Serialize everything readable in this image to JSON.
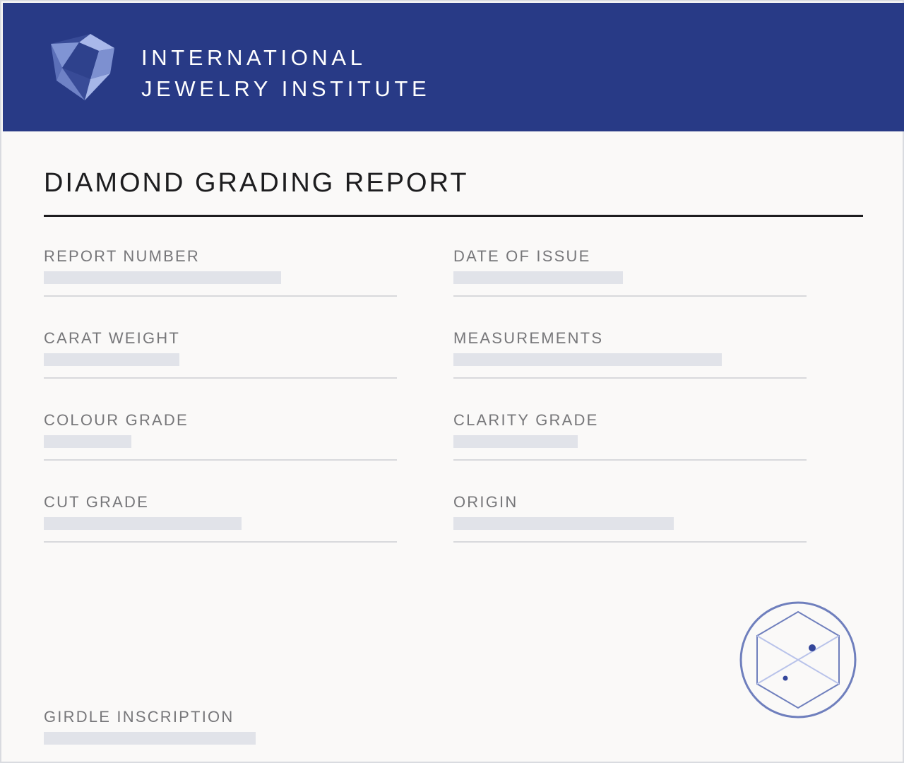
{
  "header": {
    "org_line1": "INTERNATIONAL",
    "org_line2": "JEWELRY INSTITUTE",
    "logo_icon": "shield-triangle-logo-icon",
    "background_color": "#283a86"
  },
  "report": {
    "title": "DIAMOND GRADING REPORT"
  },
  "fields": {
    "report_number": {
      "label": "REPORT NUMBER",
      "value": ""
    },
    "date_of_issue": {
      "label": "DATE OF ISSUE",
      "value": ""
    },
    "carat_weight": {
      "label": "CARAT WEIGHT",
      "value": ""
    },
    "measurements": {
      "label": "MEASUREMENTS",
      "value": ""
    },
    "colour_grade": {
      "label": "COLOUR GRADE",
      "value": ""
    },
    "clarity_grade": {
      "label": "CLARITY GRADE",
      "value": ""
    },
    "cut_grade": {
      "label": "CUT GRADE",
      "value": ""
    },
    "origin": {
      "label": "ORIGIN",
      "value": ""
    }
  },
  "girdle_inscription": {
    "label": "GIRDLE INSCRIPTION",
    "value": ""
  },
  "seal": {
    "icon": "hexagon-seal-icon",
    "color": "#6f7fbd"
  },
  "colors": {
    "placeholder_bar": "#e1e3e9",
    "label_text": "#77777a",
    "title_text": "#1d1d1f"
  }
}
